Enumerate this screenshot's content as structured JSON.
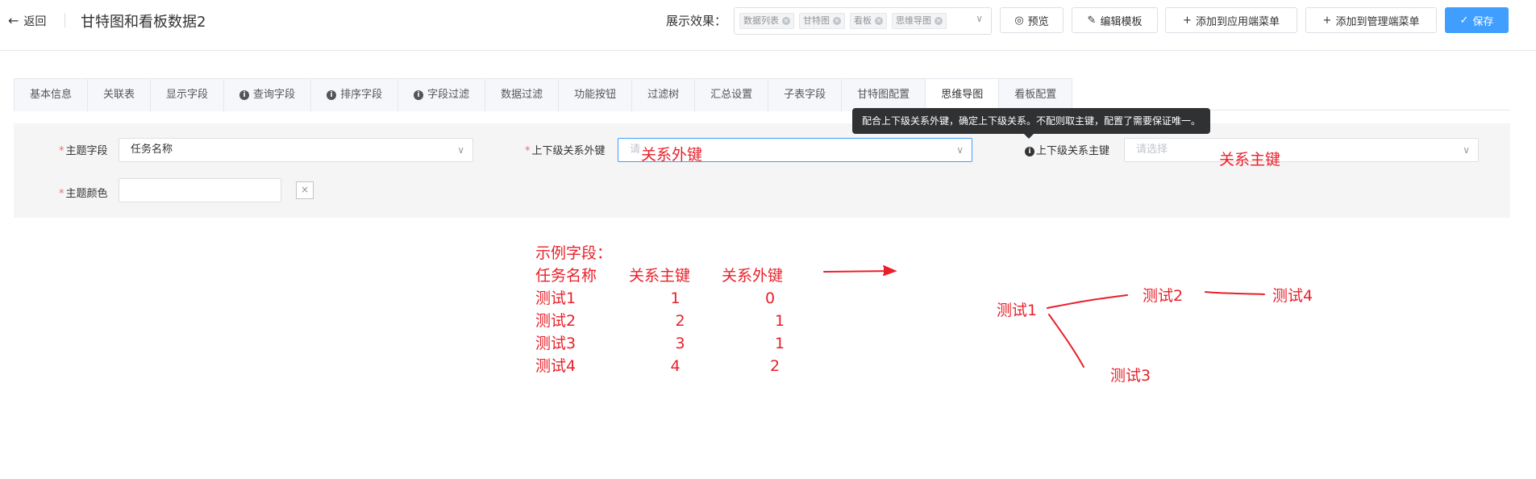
{
  "header": {
    "back_label": "返回",
    "title": "甘特图和看板数据2",
    "display_label": "展示效果：",
    "display_tags": [
      "数据列表",
      "甘特图",
      "看板",
      "思维导图"
    ],
    "buttons": {
      "preview": "预览",
      "edit_template": "编辑模板",
      "add_app_menu": "添加到应用端菜单",
      "add_admin_menu": "添加到管理端菜单",
      "save": "保存"
    }
  },
  "tabs": [
    {
      "label": "基本信息",
      "info": false,
      "active": false
    },
    {
      "label": "关联表",
      "info": false,
      "active": false
    },
    {
      "label": "显示字段",
      "info": false,
      "active": false
    },
    {
      "label": "查询字段",
      "info": true,
      "active": false
    },
    {
      "label": "排序字段",
      "info": true,
      "active": false
    },
    {
      "label": "字段过滤",
      "info": true,
      "active": false
    },
    {
      "label": "数据过滤",
      "info": false,
      "active": false
    },
    {
      "label": "功能按钮",
      "info": false,
      "active": false
    },
    {
      "label": "过滤树",
      "info": false,
      "active": false
    },
    {
      "label": "汇总设置",
      "info": false,
      "active": false
    },
    {
      "label": "子表字段",
      "info": false,
      "active": false
    },
    {
      "label": "甘特图配置",
      "info": false,
      "active": false
    },
    {
      "label": "思维导图",
      "info": false,
      "active": true
    },
    {
      "label": "看板配置",
      "info": false,
      "active": false
    }
  ],
  "form": {
    "topic_field": {
      "label": "主题字段",
      "value": "任务名称"
    },
    "parent_fk": {
      "label": "上下级关系外键",
      "placeholder_prefix": "请"
    },
    "parent_pk": {
      "label": "上下级关系主键",
      "placeholder": "请选择"
    },
    "topic_color": {
      "label": "主题颜色",
      "value": ""
    },
    "clear_symbol": "×",
    "tooltip": "配合上下级关系外键，确定上下级关系。不配则取主键，配置了需要保证唯一。"
  },
  "annotations": {
    "fk_note": "关系外键",
    "pk_note": "关系主键",
    "example_title": "示例字段：",
    "example_headers": [
      "任务名称",
      "关系主键",
      "关系外键"
    ],
    "example_rows": [
      [
        "测试1",
        "1",
        "0"
      ],
      [
        "测试2",
        "2",
        "1"
      ],
      [
        "测试3",
        "3",
        "1"
      ],
      [
        "测试4",
        "4",
        "2"
      ]
    ],
    "tree_nodes": {
      "n1": "测试1",
      "n2": "测试2",
      "n3": "测试3",
      "n4": "测试4"
    },
    "annotation_color": "#e8202a"
  },
  "colors": {
    "primary": "#409eff",
    "required": "#f56c6c"
  }
}
